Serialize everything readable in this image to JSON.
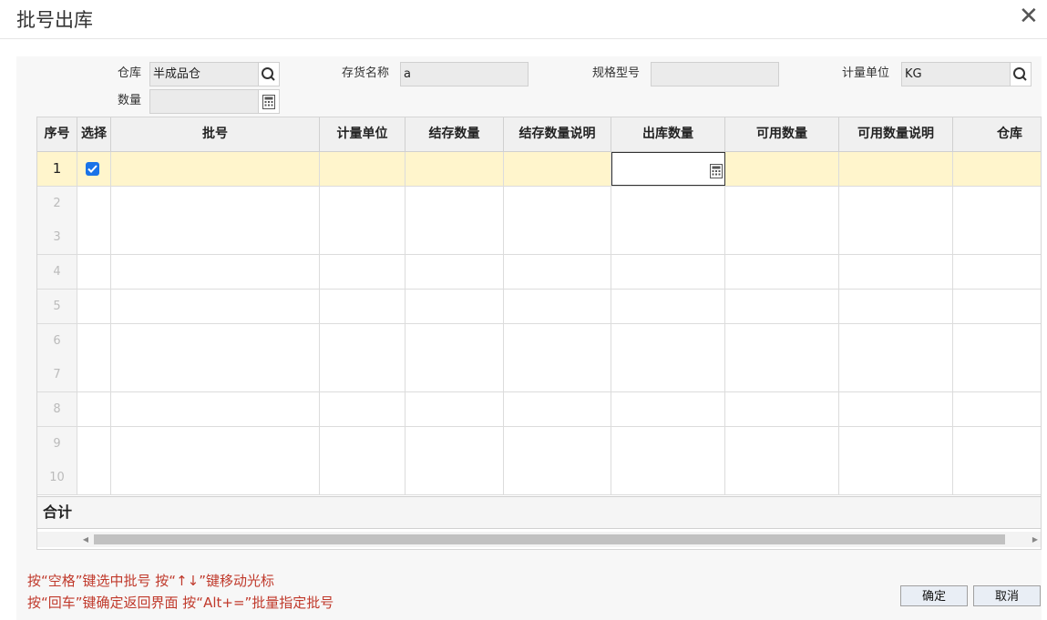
{
  "dialog": {
    "title": "批号出库"
  },
  "form": {
    "warehouse": {
      "label": "仓库",
      "value": "半成品仓"
    },
    "quantity": {
      "label": "数量",
      "value": ""
    },
    "item_name": {
      "label": "存货名称",
      "value": "a"
    },
    "spec": {
      "label": "规格型号",
      "value": ""
    },
    "unit": {
      "label": "计量单位",
      "value": "KG"
    }
  },
  "table": {
    "columns": [
      "序号",
      "选择",
      "批号",
      "计量单位",
      "结存数量",
      "结存数量说明",
      "出库数量",
      "可用数量",
      "可用数量说明",
      "仓库"
    ],
    "rows": [
      {
        "no": "1",
        "checked": true,
        "batch": "",
        "unit": "",
        "stock_qty": "",
        "stock_desc": "",
        "out_qty": "",
        "avail_qty": "",
        "avail_desc": "",
        "warehouse": ""
      },
      {
        "no": "2"
      },
      {
        "no": "3"
      },
      {
        "no": "4"
      },
      {
        "no": "5"
      },
      {
        "no": "6"
      },
      {
        "no": "7"
      },
      {
        "no": "8"
      },
      {
        "no": "9"
      },
      {
        "no": "10"
      }
    ],
    "total_label": "合计"
  },
  "hints": {
    "line1": "按“空格”键选中批号    按“↑↓”键移动光标",
    "line2": "按“回车”键确定返回界面  按“Alt+=”批量指定批号"
  },
  "buttons": {
    "ok": "确定",
    "cancel": "取消"
  },
  "colors": {
    "selected_row": "#fff5cc",
    "hint_text": "#c0392b",
    "checkbox": "#1a73e8"
  }
}
